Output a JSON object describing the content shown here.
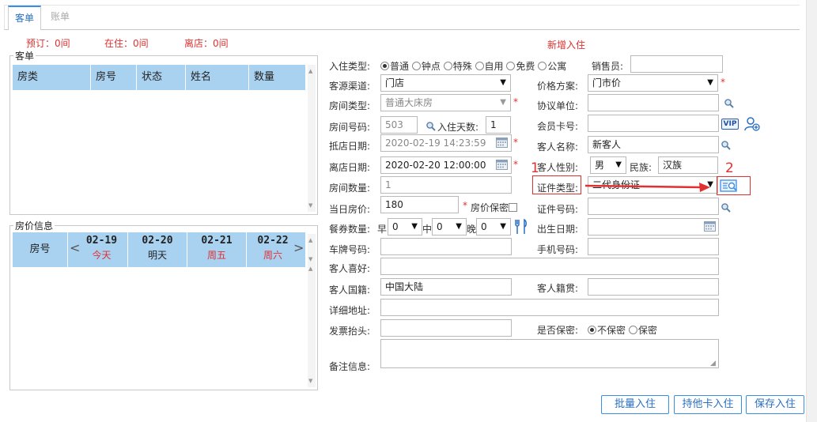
{
  "tabs": [
    {
      "label": "客单"
    },
    {
      "label": "账单"
    }
  ],
  "summary": {
    "reserved": "预订：0间",
    "staying": "在住：0间",
    "departed": "离店：0间"
  },
  "form_title": "新增入住",
  "guest_panel": {
    "legend": "客单",
    "columns": [
      "房类",
      "房号",
      "状态",
      "姓名",
      "数量"
    ]
  },
  "price_panel": {
    "legend": "房价信息",
    "room_no_header": "房号",
    "prev": "<",
    "next": ">",
    "dates": [
      {
        "date": "02-19",
        "weekday": "今天"
      },
      {
        "date": "02-20",
        "weekday": "明天"
      },
      {
        "date": "02-21",
        "weekday": "周五"
      },
      {
        "date": "02-22",
        "weekday": "周六"
      }
    ]
  },
  "form": {
    "checkin_type_label": "入住类型:",
    "checkin_types": [
      {
        "label": "普通",
        "selected": true
      },
      {
        "label": "钟点",
        "selected": false
      },
      {
        "label": "特殊",
        "selected": false
      },
      {
        "label": "自用",
        "selected": false
      },
      {
        "label": "免费",
        "selected": false
      },
      {
        "label": "公寓",
        "selected": false
      }
    ],
    "salesperson_label": "销售员:",
    "salesperson_value": "",
    "source_label": "客源渠道:",
    "source_value": "门店",
    "price_plan_label": "价格方案:",
    "price_plan_value": "门市价",
    "room_type_label": "房间类型:",
    "room_type_value": "普通大床房",
    "agreement_label": "协议单位:",
    "agreement_value": "",
    "room_no_label": "房间号码:",
    "room_no_value": "503",
    "days_label": "入住天数:",
    "days_value": "1",
    "member_label": "会员卡号:",
    "member_value": "",
    "vip": "VIP",
    "arrival_label": "抵店日期:",
    "arrival_value": "2020-02-19 14:23:59",
    "guest_name_label": "客人名称:",
    "guest_name_value": "新客人",
    "departure_label": "离店日期:",
    "departure_value": "2020-02-20 12:00:00",
    "gender_label": "客人性别:",
    "gender_value": "男",
    "ethnicity_label": "民族:",
    "ethnicity_value": "汉族",
    "room_count_label": "房间数量:",
    "room_count_value": "1",
    "id_type_label": "证件类型:",
    "id_type_value": "二代身份证",
    "daily_price_label": "当日房价:",
    "daily_price_value": "180",
    "price_secret_label": "房价保密",
    "id_no_label": "证件号码:",
    "id_no_value": "",
    "meal_label": "餐券数量:",
    "breakfast_label": "早",
    "breakfast_value": "0",
    "lunch_label": "中",
    "lunch_value": "0",
    "dinner_label": "晚",
    "dinner_value": "0",
    "birth_label": "出生日期:",
    "birth_value": "",
    "plate_label": "车牌号码:",
    "plate_value": "",
    "phone_label": "手机号码:",
    "phone_value": "",
    "preference_label": "客人喜好:",
    "preference_value": "",
    "nationality_label": "客人国籍:",
    "nationality_value": "中国大陆",
    "native_label": "客人籍贯:",
    "native_value": "",
    "address_label": "详细地址:",
    "address_value": "",
    "invoice_label": "发票抬头:",
    "invoice_value": "",
    "confidential_label": "是否保密:",
    "confidential_options": [
      {
        "label": "不保密",
        "selected": true
      },
      {
        "label": "保密",
        "selected": false
      }
    ],
    "remark_label": "备注信息:",
    "remark_value": ""
  },
  "annotations": {
    "one": "1",
    "two": "2"
  },
  "buttons": {
    "batch": "批量入住",
    "other_card": "持他卡入住",
    "save": "保存入住"
  },
  "colors": {
    "accent": "#3a8ee6",
    "header_bg": "#a9d2f1",
    "required": "#e03030"
  }
}
